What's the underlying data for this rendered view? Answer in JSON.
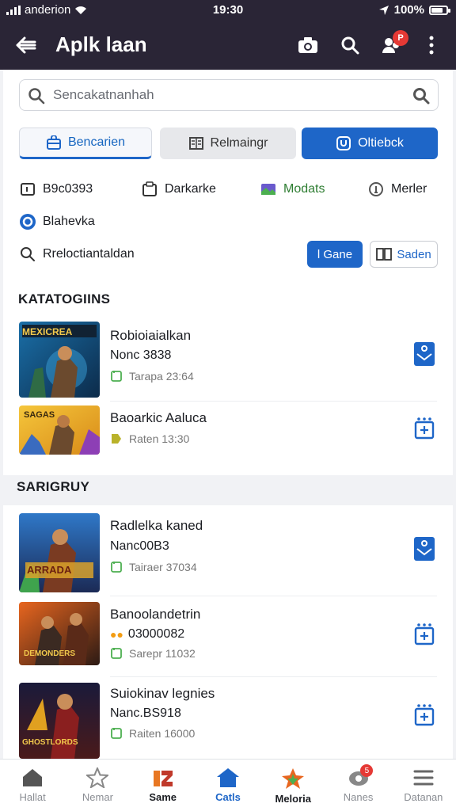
{
  "status_bar": {
    "carrier": "anderion",
    "time": "19:30",
    "battery": "100%"
  },
  "app_bar": {
    "title": "Aplk laan",
    "notification_count": "P"
  },
  "search": {
    "placeholder": "Sencakatnanhah"
  },
  "filter_buttons": [
    {
      "label": "Bencarien"
    },
    {
      "label": "Relmaingr"
    },
    {
      "label": "Oltiebck"
    }
  ],
  "quick_links": [
    {
      "label": "B9c0393"
    },
    {
      "label": "Darkarke"
    },
    {
      "label": "Modats"
    },
    {
      "label": "Merler"
    },
    {
      "label": "Blahevka"
    }
  ],
  "sort": {
    "label": "Rreloctiantaldan",
    "game_button": "l Gane",
    "saden_button": "Saden"
  },
  "categories": {
    "title": "KATATOGIINS",
    "items": [
      {
        "title": "Robioiaialkan",
        "subtitle": "Nonc 3838",
        "meta": "Tarapa 23:64",
        "thumb_text": "MEXICREA"
      },
      {
        "title": "Baoarkic Aaluca",
        "subtitle": "",
        "meta": "Raten 13:30",
        "thumb_text": "SAGAS"
      }
    ]
  },
  "sarigruy": {
    "title": "SARIGRUY",
    "items": [
      {
        "title": "Radlelka kaned",
        "subtitle": "Nanc00B3",
        "meta": "Tairaer 37034",
        "thumb_text": "ARRADA"
      },
      {
        "title": "Banoolandetrin",
        "subtitle": "03000082",
        "meta": "Sarepr 11032",
        "thumb_text": "DEMONDERS"
      },
      {
        "title": "Suiokinav legnies",
        "subtitle": "Nanc.BS918",
        "meta": "Raiten 16000",
        "thumb_text": "GHOSTLORDS"
      }
    ]
  },
  "bottom_nav": [
    {
      "label": "Hallat"
    },
    {
      "label": "Nemar"
    },
    {
      "label": "Same"
    },
    {
      "label": "Catls"
    },
    {
      "label": "Meloria"
    },
    {
      "label": "Nanes"
    },
    {
      "label": "Datanan"
    }
  ],
  "bottom_nav_badge": "5",
  "colors": {
    "app_bar": "#2a2536",
    "accent_blue": "#1e66c8",
    "badge_red": "#e53935",
    "meta_green": "#4caf50"
  }
}
